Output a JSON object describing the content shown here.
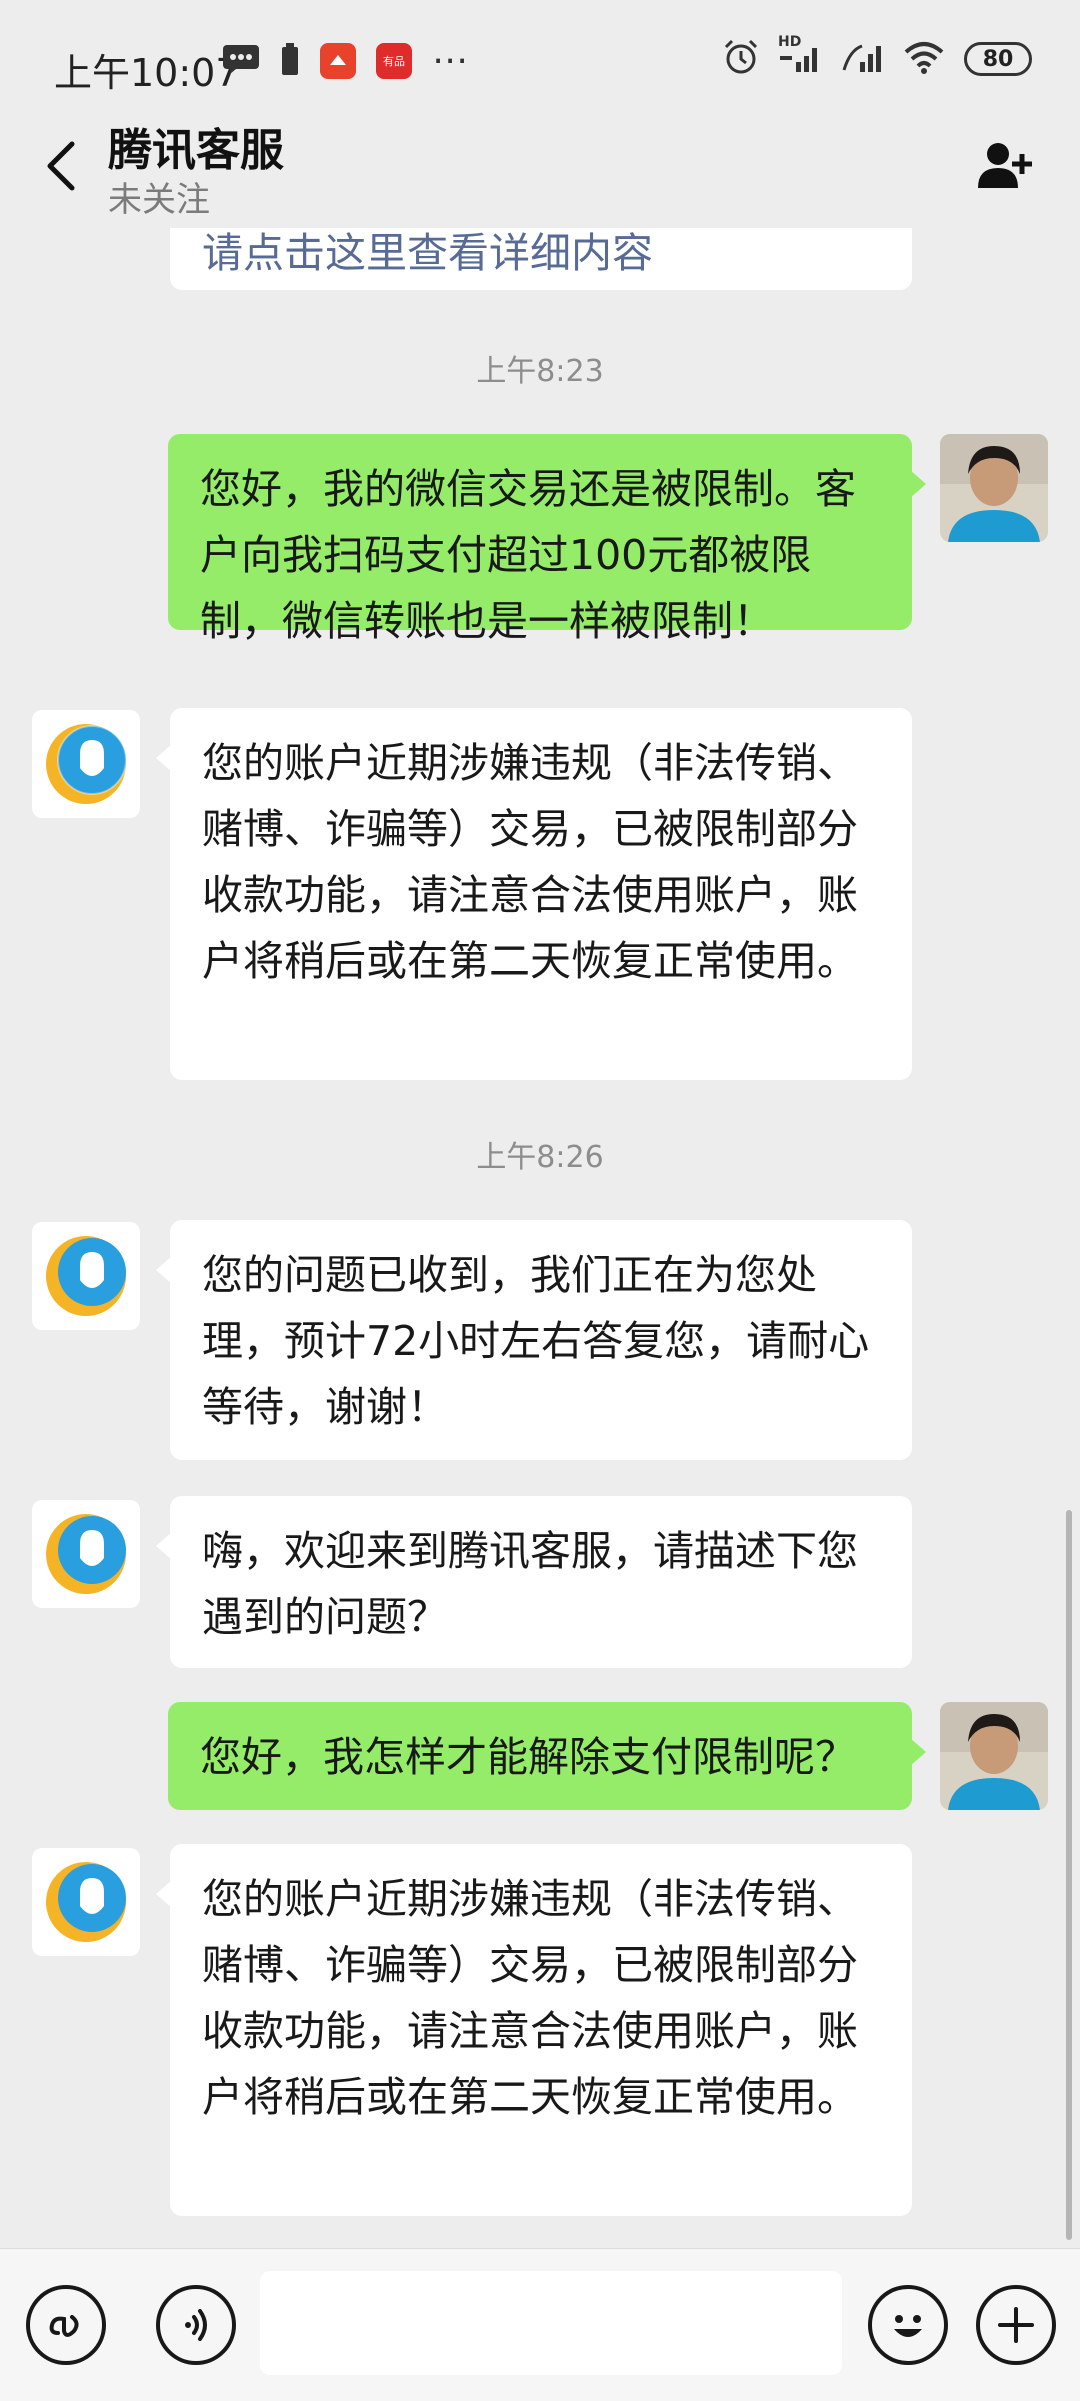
{
  "status_bar": {
    "time": "上午10:07",
    "battery": "80",
    "network_label": "HD",
    "icons": [
      "message-icon",
      "battery-saver-icon",
      "app-badge-icon",
      "app-badge-icon",
      "more-dots-icon",
      "alarm-icon",
      "signal-icon",
      "signal-icon",
      "wifi-icon",
      "battery-icon"
    ],
    "app_badge_2_text": "有品"
  },
  "header": {
    "title": "腾讯客服",
    "subtitle": "未关注"
  },
  "chat": {
    "partial_message": "请点击这里查看详细内容",
    "time_1": "上午8:23",
    "msg_1": "您好，我的微信交易还是被限制。客户向我扫码支付超过100元都被限制，微信转账也是一样被限制！",
    "msg_2": "您的账户近期涉嫌违规（非法传销、赌博、诈骗等）交易，已被限制部分收款功能，请注意合法使用账户，账户将稍后或在第二天恢复正常使用。",
    "time_2": "上午8:26",
    "msg_3": "您的问题已收到，我们正在为您处理，预计72小时左右答复您，请耐心等待，谢谢！",
    "msg_4": "嗨，欢迎来到腾讯客服，请描述下您遇到的问题？",
    "msg_5": "您好，我怎样才能解除支付限制呢？",
    "msg_6": "您的账户近期涉嫌违规（非法传销、赌博、诈骗等）交易，已被限制部分收款功能，请注意合法使用账户，账户将稍后或在第二天恢复正常使用。"
  },
  "bottom_bar": {
    "input_value": ""
  },
  "colors": {
    "background": "#ededed",
    "my_bubble": "#95ec69",
    "their_bubble": "#ffffff",
    "link": "#576b95",
    "timestamp": "#8d8d8d"
  }
}
